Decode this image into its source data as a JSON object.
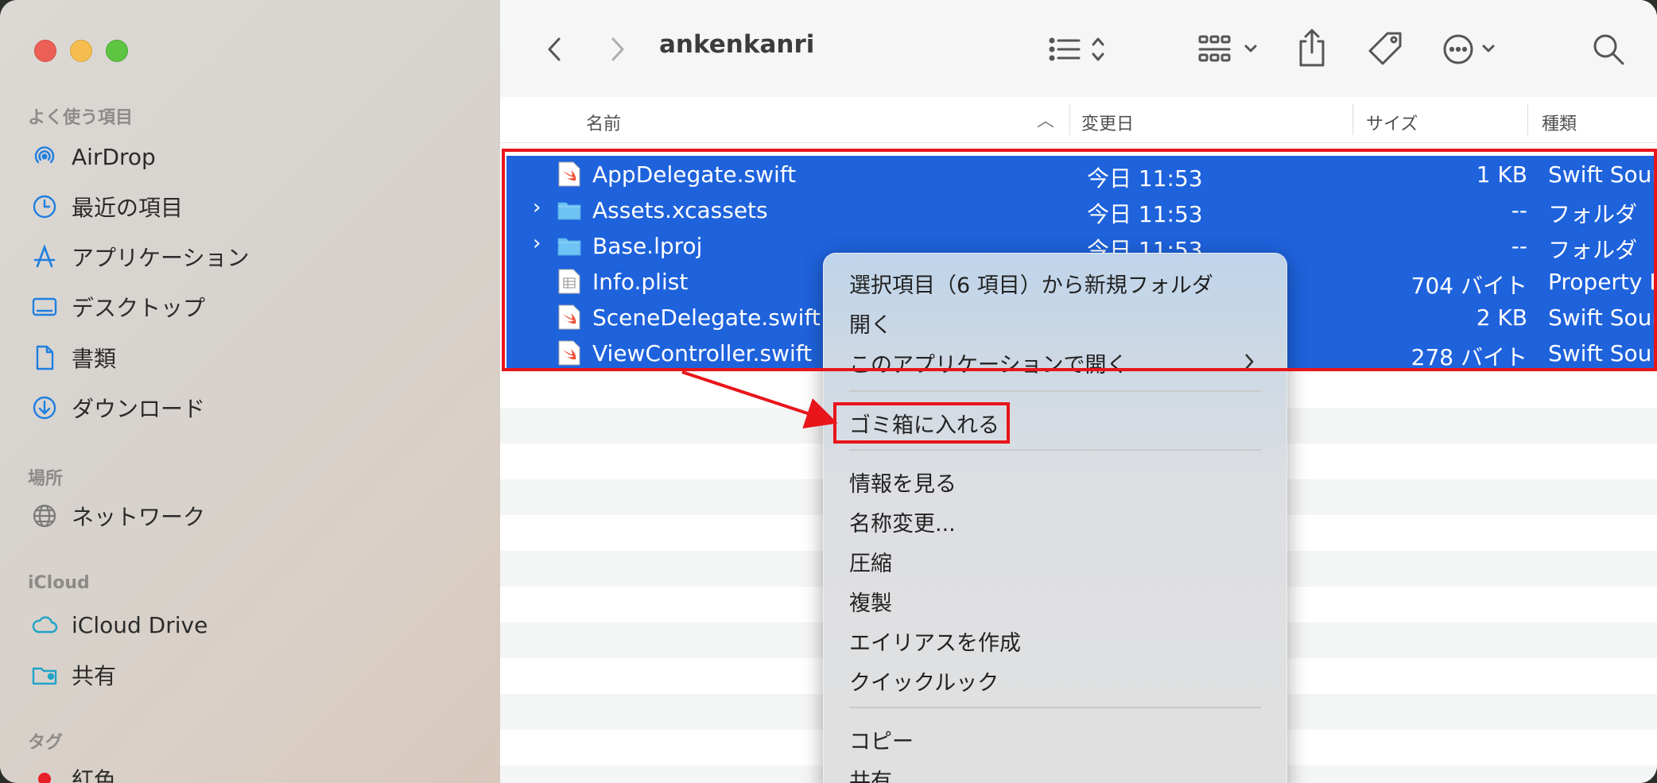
{
  "window": {
    "title": "ankenkanri"
  },
  "sidebar": {
    "sections": [
      {
        "heading": "よく使う項目",
        "items": [
          {
            "label": "AirDrop",
            "icon": "airdrop-icon"
          },
          {
            "label": "最近の項目",
            "icon": "clock-icon"
          },
          {
            "label": "アプリケーション",
            "icon": "applications-icon"
          },
          {
            "label": "デスクトップ",
            "icon": "desktop-icon"
          },
          {
            "label": "書類",
            "icon": "document-icon"
          },
          {
            "label": "ダウンロード",
            "icon": "download-icon"
          }
        ]
      },
      {
        "heading": "場所",
        "items": [
          {
            "label": "ネットワーク",
            "icon": "network-globe-icon"
          }
        ]
      },
      {
        "heading": "iCloud",
        "items": [
          {
            "label": "iCloud Drive",
            "icon": "cloud-icon"
          },
          {
            "label": "共有",
            "icon": "shared-folder-icon"
          }
        ]
      },
      {
        "heading": "タグ",
        "items": [
          {
            "label": "紅色",
            "icon": "red-tag-dot-icon"
          }
        ]
      }
    ]
  },
  "columns": {
    "name": "名前",
    "date": "変更日",
    "size": "サイズ",
    "kind": "種類"
  },
  "files": [
    {
      "name": "AppDelegate.swift",
      "date": "今日 11:53",
      "size": "1 KB",
      "kind": "Swift Sour",
      "type": "swift",
      "expandable": false
    },
    {
      "name": "Assets.xcassets",
      "date": "今日 11:53",
      "size": "--",
      "kind": "フォルダ",
      "type": "folder",
      "expandable": true
    },
    {
      "name": "Base.lproj",
      "date": "今日 11:53",
      "size": "--",
      "kind": "フォルダ",
      "type": "folder",
      "expandable": true
    },
    {
      "name": "Info.plist",
      "date": "",
      "size": "704 バイト",
      "kind": "Property L",
      "type": "plist",
      "expandable": false
    },
    {
      "name": "SceneDelegate.swift",
      "date": "",
      "size": "2 KB",
      "kind": "Swift Sour",
      "type": "swift",
      "expandable": false
    },
    {
      "name": "ViewController.swift",
      "date": "",
      "size": "278 バイト",
      "kind": "Swift Sour",
      "type": "swift",
      "expandable": false
    }
  ],
  "context_menu": {
    "new_folder": "選択項目（6 項目）から新規フォルダ",
    "open": "開く",
    "open_with": "このアプリケーションで開く",
    "move_to_trash": "ゴミ箱に入れる",
    "get_info": "情報を見る",
    "rename": "名称変更...",
    "compress": "圧縮",
    "duplicate": "複製",
    "make_alias": "エイリアスを作成",
    "quick_look": "クイックルック",
    "copy": "コピー",
    "share": "共有..."
  },
  "colors": {
    "selection": "#1e62dc",
    "annotation": "#e8151b",
    "accent_icon": "#1e7fe0"
  }
}
